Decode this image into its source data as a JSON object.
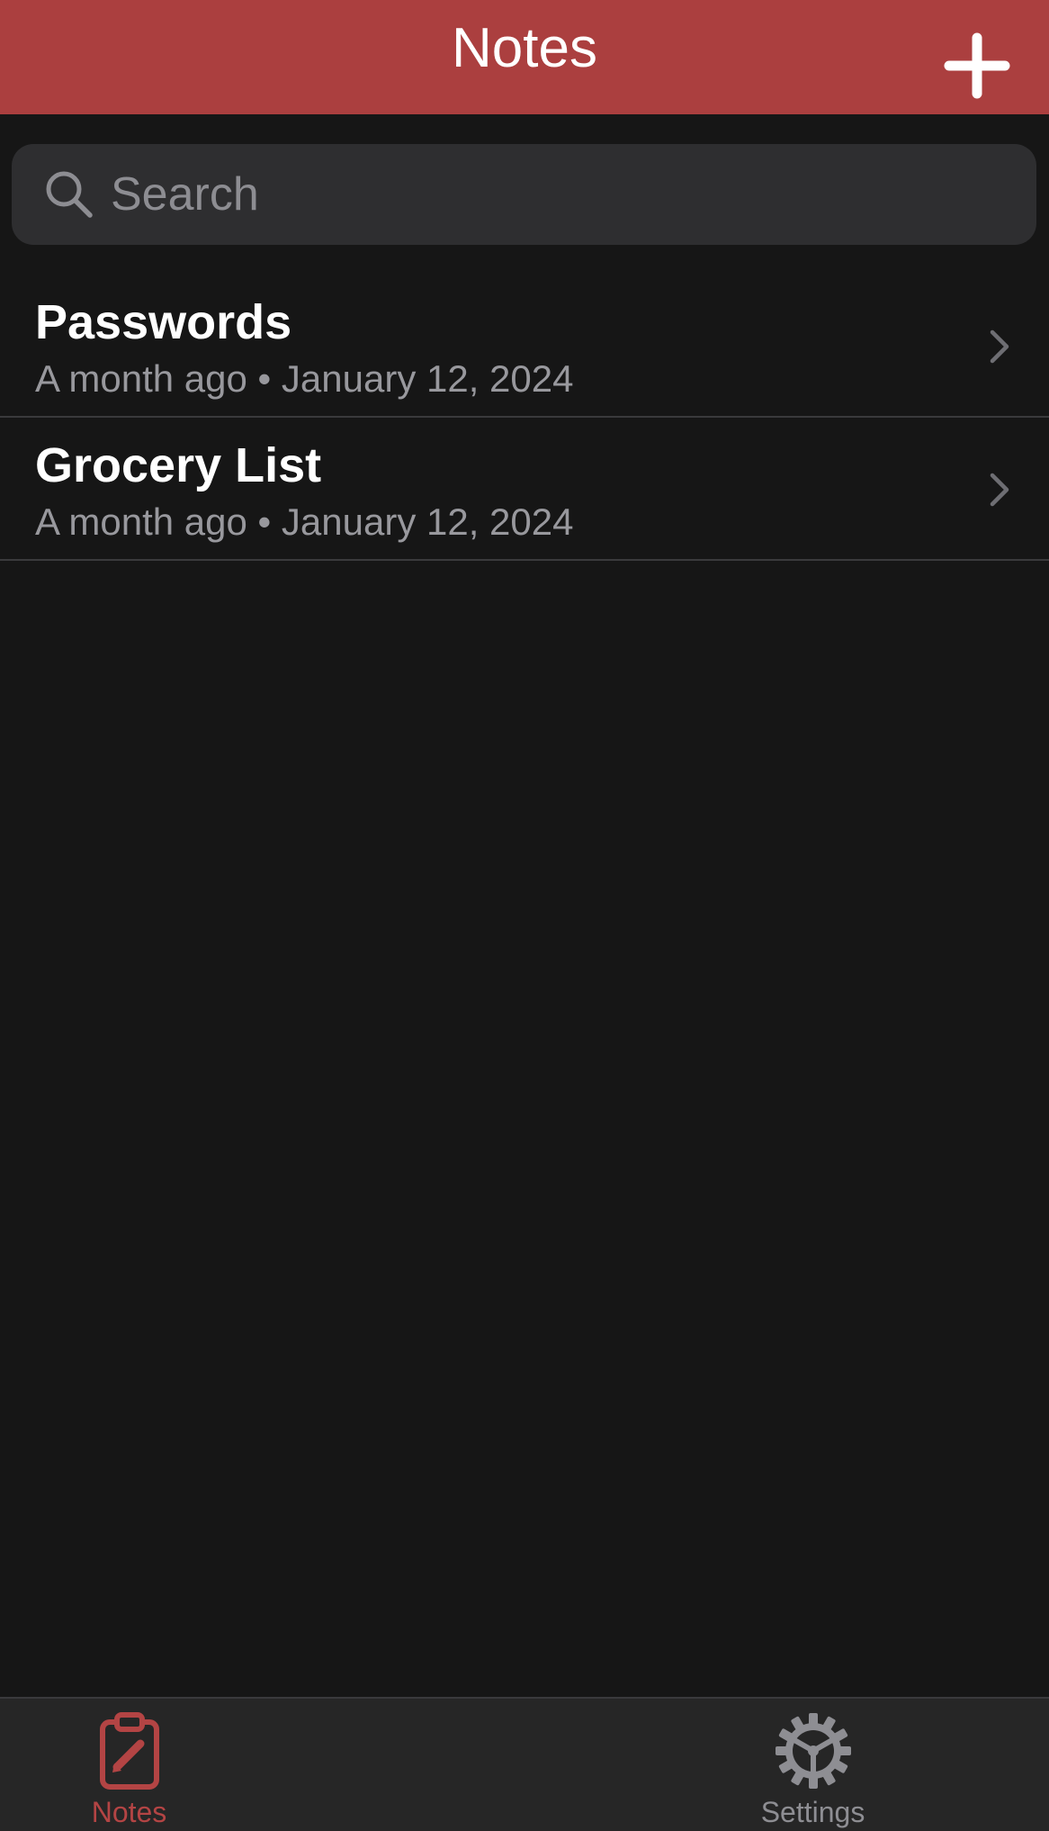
{
  "header": {
    "title": "Notes",
    "add_icon": "plus-icon"
  },
  "search": {
    "placeholder": "Search",
    "value": "",
    "icon": "search-icon"
  },
  "notes": [
    {
      "title": "Passwords",
      "relative": "A month ago",
      "separator": "•",
      "date": "January 12, 2024"
    },
    {
      "title": "Grocery List",
      "relative": "A month ago",
      "separator": "•",
      "date": "January 12, 2024"
    }
  ],
  "tabs": [
    {
      "label": "Notes",
      "icon": "clipboard-pencil-icon",
      "active": true
    },
    {
      "label": "Settings",
      "icon": "gear-icon",
      "active": false
    }
  ],
  "colors": {
    "accent": "#ab3f3f",
    "tab_active": "#b34444",
    "tab_inactive": "#8e8e93",
    "background": "#161616"
  }
}
